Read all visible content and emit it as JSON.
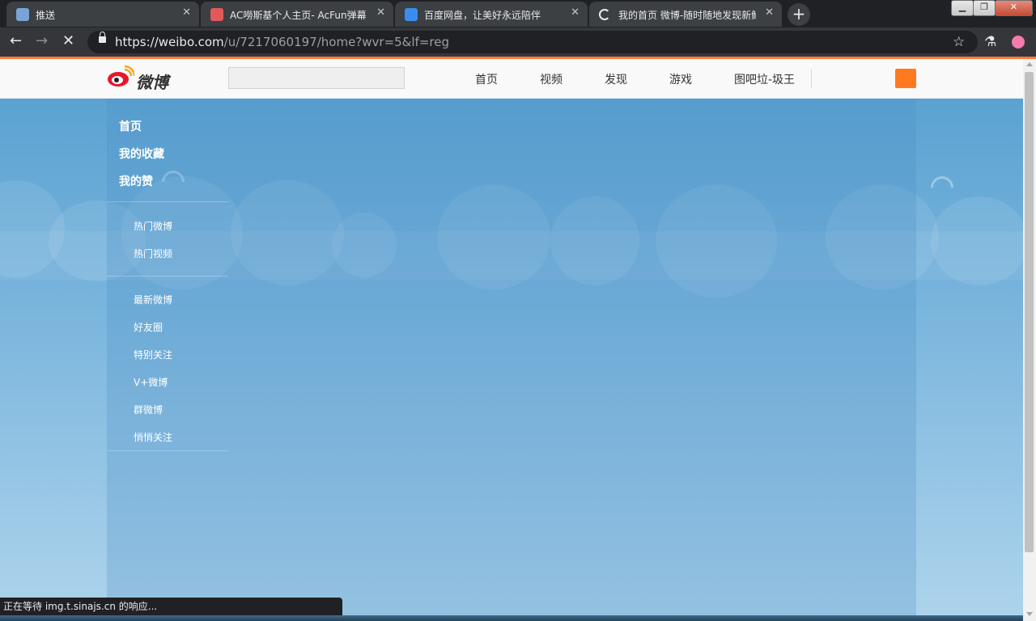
{
  "browser": {
    "tabs": [
      {
        "title": "推送",
        "favicon_color": "#7aa3d6"
      },
      {
        "title": "AC嘮斯基个人主页- AcFun弹幕",
        "favicon_color": "#e15a5a"
      },
      {
        "title": "百度网盘，让美好永远陪伴",
        "favicon_color": "#3a8df0"
      },
      {
        "title": "我的首页 微博-随时随地发现新鲜",
        "favicon_color": "#ffffff"
      }
    ],
    "new_tab_label": "+",
    "url_host": "https://weibo.com",
    "url_path": "/u/7217060197/home?wvr=5&lf=reg",
    "status_text": "正在等待 img.t.sinajs.cn 的响应..."
  },
  "weibo": {
    "logo_text": "微博",
    "search_placeholder": "",
    "nav": [
      "首页",
      "视频",
      "发现",
      "游戏",
      "图吧垃-圾王"
    ],
    "sidebar": {
      "main": [
        "首页",
        "我的收藏",
        "我的赞"
      ],
      "group1": [
        "热门微博",
        "热门视频"
      ],
      "group2": [
        "最新微博",
        "好友圈",
        "特别关注",
        "V+微博",
        "群微博",
        "悄悄关注"
      ]
    }
  },
  "colors": {
    "accent_orange": "#fa7d3c",
    "weibo_red": "#e6162d",
    "sky_blue": "#559fd0"
  },
  "icons": [
    "back-icon",
    "forward-icon",
    "stop-icon",
    "lock-icon",
    "star-icon",
    "extension-icon",
    "profile-icon"
  ]
}
